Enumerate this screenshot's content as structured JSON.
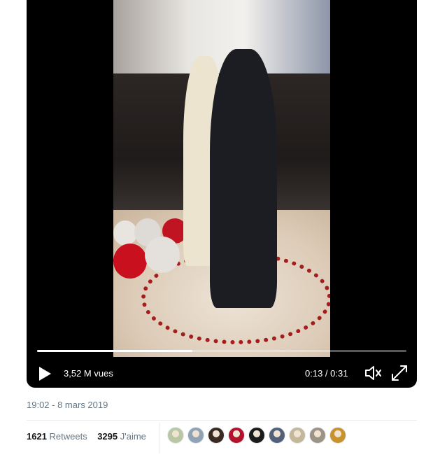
{
  "video": {
    "views_label": "3,52 M vues",
    "current_time": "0:13",
    "separator": " / ",
    "duration": "0:31",
    "progress_fraction": 0.42
  },
  "tweet": {
    "timestamp": "19:02 - 8 mars 2019",
    "retweets_count": "1621",
    "retweets_label": "Retweets",
    "likes_count": "3295",
    "likes_label": "J'aime"
  },
  "likers": [
    {
      "color": "#b9c7a4"
    },
    {
      "color": "#8fa3b5"
    },
    {
      "color": "#3a2a22"
    },
    {
      "color": "#b3122b"
    },
    {
      "color": "#1b1b1b"
    },
    {
      "color": "#52607a"
    },
    {
      "color": "#c4b89a"
    },
    {
      "color": "#9c9387"
    },
    {
      "color": "#c8922f"
    }
  ],
  "colors": {
    "secondary_text": "#657786",
    "primary_text": "#14171a",
    "divider": "#e6ecf0"
  }
}
